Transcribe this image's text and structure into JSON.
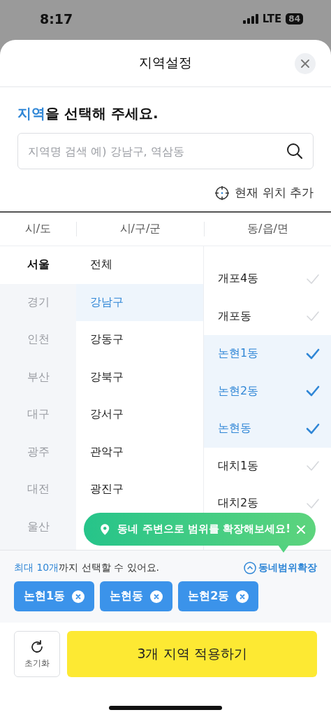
{
  "status_bar": {
    "time": "8:17",
    "network": "LTE",
    "battery": "84"
  },
  "sheet": {
    "title": "지역설정"
  },
  "heading": {
    "highlight": "지역",
    "rest": "을 선택해 주세요."
  },
  "search": {
    "placeholder": "지역명 검색 예) 강남구, 역삼동"
  },
  "current_location": "현재 위치 추가",
  "columns": [
    {
      "label": "시/도"
    },
    {
      "label": "시/구/군"
    },
    {
      "label": "동/읍/면"
    }
  ],
  "provinces": [
    {
      "label": "서울",
      "selected": true
    },
    {
      "label": "경기",
      "selected": false
    },
    {
      "label": "인천",
      "selected": false
    },
    {
      "label": "부산",
      "selected": false
    },
    {
      "label": "대구",
      "selected": false
    },
    {
      "label": "광주",
      "selected": false
    },
    {
      "label": "대전",
      "selected": false
    },
    {
      "label": "울산",
      "selected": false
    }
  ],
  "districts": [
    {
      "label": "전체",
      "selected": false
    },
    {
      "label": "강남구",
      "selected": true
    },
    {
      "label": "강동구",
      "selected": false
    },
    {
      "label": "강북구",
      "selected": false
    },
    {
      "label": "강서구",
      "selected": false
    },
    {
      "label": "관악구",
      "selected": false
    },
    {
      "label": "광진구",
      "selected": false
    }
  ],
  "neighborhoods": [
    {
      "label": "개포4동",
      "selected": false
    },
    {
      "label": "개포동",
      "selected": false
    },
    {
      "label": "논현1동",
      "selected": true
    },
    {
      "label": "논현2동",
      "selected": true
    },
    {
      "label": "논현동",
      "selected": true
    },
    {
      "label": "대치1동",
      "selected": false
    },
    {
      "label": "대치2동",
      "selected": false
    }
  ],
  "tooltip": {
    "text": "동네 주변으로 범위를 확장해보세요!"
  },
  "limit_notice": {
    "highlight": "최대 10개",
    "rest": "까지 선택할 수 있어요."
  },
  "expand_link": "동네범위확장",
  "chips": [
    {
      "label": "논현1동"
    },
    {
      "label": "논현동"
    },
    {
      "label": "논현2동"
    }
  ],
  "reset_button": "초기화",
  "apply_button": "3개 지역 적용하기"
}
